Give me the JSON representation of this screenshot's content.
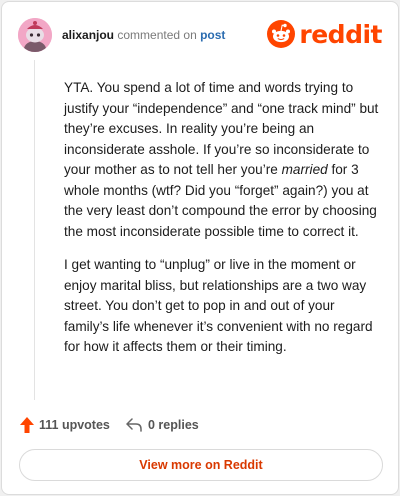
{
  "header": {
    "username": "alixanjou",
    "action_text": "commented on",
    "post_link": "post",
    "logo_text": "reddit",
    "brand_color": "#ff4500"
  },
  "comment": {
    "p1_a": "YTA. You spend a lot of time and words trying to justify your “independence” and “one track mind” but they’re excuses. In reality you’re being an inconsiderate asshole. If you’re so inconsiderate to your mother as to not tell her you’re ",
    "p1_em": "married",
    "p1_b": " for 3 whole months (wtf? Did you “forget” again?) you at the very least don’t compound the error by choosing the most inconsiderate possible time to correct it.",
    "p2": "I get wanting to “unplug” or live in the moment or enjoy marital bliss, but relationships are a two way street. You don’t get to pop in and out of your family’s life whenever it’s convenient with no regard for how it affects them or their timing."
  },
  "footer": {
    "upvotes": "111 upvotes",
    "replies": "0 replies",
    "upvote_icon": "upvote-arrow-icon",
    "reply_icon": "reply-arrow-icon",
    "view_more_label": "View more on Reddit"
  }
}
